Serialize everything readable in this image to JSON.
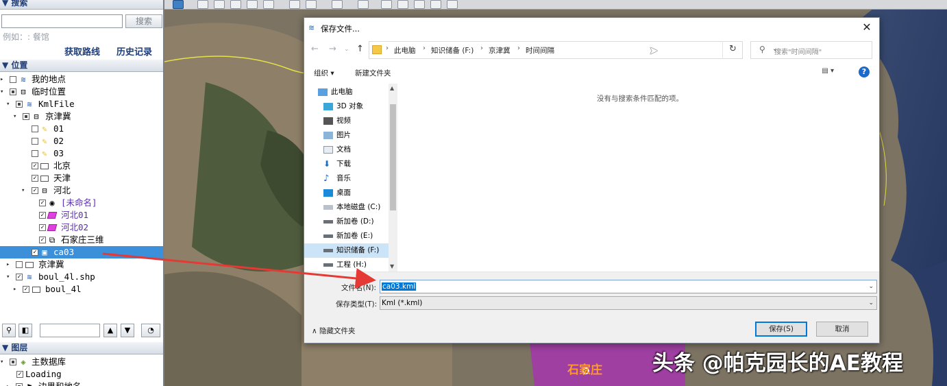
{
  "left_panel": {
    "search_section": "▼ 搜索",
    "search_button": "搜索",
    "search_hint": "例如：: 餐馆",
    "get_route": "获取路线",
    "history": "历史记录",
    "places_section": "▼ 位置",
    "tree": [
      {
        "label": "我的地点"
      },
      {
        "label": "临时位置"
      },
      {
        "label": "KmlFile"
      },
      {
        "label": "京津冀"
      },
      {
        "label": "01"
      },
      {
        "label": "02"
      },
      {
        "label": "03"
      },
      {
        "label": "北京"
      },
      {
        "label": "天津"
      },
      {
        "label": "河北"
      },
      {
        "label": "[未命名]"
      },
      {
        "label": "河北01"
      },
      {
        "label": "河北02"
      },
      {
        "label": "石家庄三维"
      },
      {
        "label": "ca03"
      },
      {
        "label": "京津冀"
      },
      {
        "label": "boul_4l.shp"
      },
      {
        "label": "boul_4l"
      }
    ],
    "layers_section": "▼ 图层",
    "layers": [
      {
        "label": "主数据库"
      },
      {
        "label": "Loading"
      },
      {
        "label": "边界和地名"
      }
    ]
  },
  "map": {
    "city_label": "石家庄",
    "watermark": "头条 @帕克园长的AE教程"
  },
  "dialog": {
    "title": "保存文件...",
    "close": "✕",
    "breadcrumb": [
      "此电脑",
      "知识储备 (F:)",
      "京津冀",
      "时间间隔"
    ],
    "search_placeholder": "搜索\"时间间隔\"",
    "organize": "组织 ▾",
    "new_folder": "新建文件夹",
    "help": "?",
    "nav_items": [
      {
        "label": "此电脑",
        "icon": "computer-icon"
      },
      {
        "label": "3D 对象",
        "icon": "3d-objects-icon"
      },
      {
        "label": "视频",
        "icon": "video-icon"
      },
      {
        "label": "图片",
        "icon": "pictures-icon"
      },
      {
        "label": "文档",
        "icon": "documents-icon"
      },
      {
        "label": "下载",
        "icon": "download-icon"
      },
      {
        "label": "音乐",
        "icon": "music-icon"
      },
      {
        "label": "桌面",
        "icon": "desktop-icon"
      },
      {
        "label": "本地磁盘 (C:)",
        "icon": "disk-icon"
      },
      {
        "label": "新加卷 (D:)",
        "icon": "drive-icon"
      },
      {
        "label": "新加卷 (E:)",
        "icon": "drive-icon"
      },
      {
        "label": "知识储备 (F:)",
        "icon": "drive-icon"
      },
      {
        "label": "工程 (H:)",
        "icon": "drive-icon"
      }
    ],
    "empty_message": "没有与搜索条件匹配的项。",
    "filename_label": "文件名(N):",
    "filename_value": "ca03.kml",
    "filetype_label": "保存类型(T):",
    "filetype_value": "Kml (*.kml)",
    "hide_folders": "∧ 隐藏文件夹",
    "save_button": "保存(S)",
    "cancel_button": "取消"
  },
  "colors": {
    "selection": "#3c8fd9",
    "arrow": "#e53935",
    "purple_region": "#a33aa8",
    "accent": "#0078d7"
  }
}
